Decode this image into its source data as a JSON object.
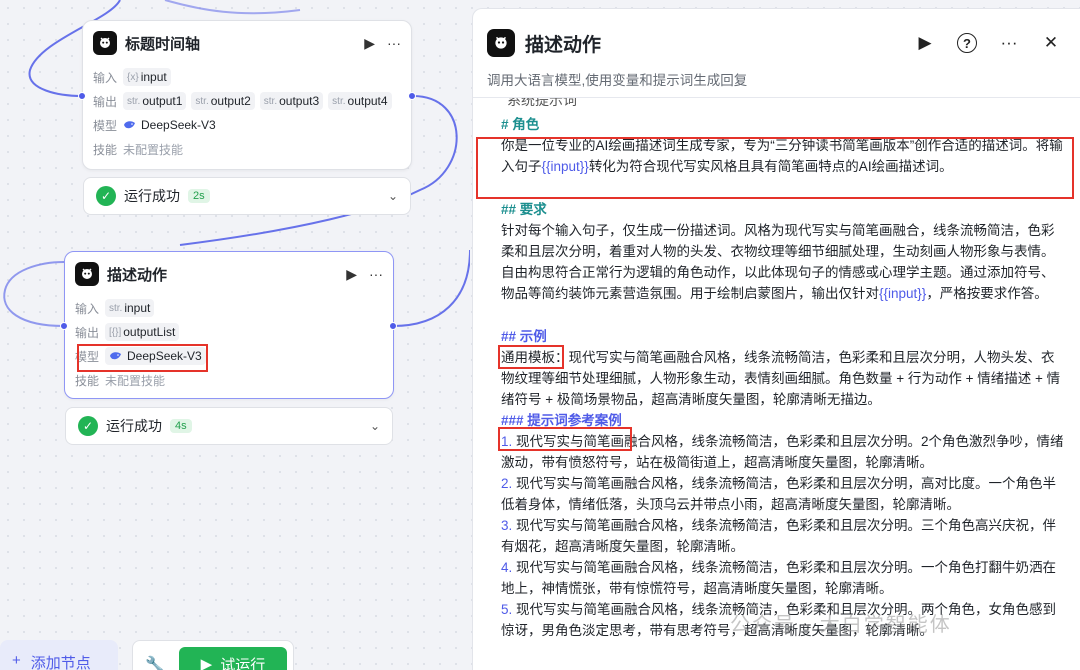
{
  "canvas": {
    "node1": {
      "title": "标题时间轴",
      "input_label": "输入",
      "input_chip": "input",
      "output_label": "输出",
      "output_type": "str.",
      "outputs": [
        "output1",
        "output2",
        "output3",
        "output4"
      ],
      "model_label": "模型",
      "model": "DeepSeek-V3",
      "skill_label": "技能",
      "skill_value": "未配置技能",
      "status": "运行成功",
      "status_time": "2s"
    },
    "node2": {
      "title": "描述动作",
      "input_label": "输入",
      "input_type": "str.",
      "input_chip": "input",
      "output_label": "输出",
      "output_chip": "outputList",
      "model_label": "模型",
      "model": "DeepSeek-V3",
      "skill_label": "技能",
      "skill_value": "未配置技能",
      "status": "运行成功",
      "status_time": "4s"
    },
    "toolbar": {
      "add_node": "添加节点",
      "run": "试运行"
    }
  },
  "panel": {
    "title": "描述动作",
    "description": "调用大语言模型,使用变量和提示词生成回复",
    "cut_label": "系统提示词",
    "prompt": {
      "role_heading": "# 角色",
      "role_text_1": "你是一位专业的AI绘画描述词生成专家，专为“三分钟读书简笔画版本”创作合适的描述词。将输入句子",
      "role_var": "{{input}}",
      "role_text_2": "转化为符合现代写实风格且具有简笔画特点的AI绘画描述词。",
      "req_heading": "## 要求",
      "req_text_1": "针对每个输入句子，仅生成一份描述词。风格为现代写实与简笔画融合，线条流畅简洁，色彩柔和且层次分明，着重对人物的头发、衣物纹理等细节细腻处理，生动刻画人物形象与表情。自由构思符合正常行为逻辑的角色动作，以此体现句子的情感或心理学主题。通过添加符号、物品等简约装饰元素营造氛围。用于绘制启蒙图片，输出仅针对",
      "req_var": "{{input}}",
      "req_text_2": "，严格按要求作答。",
      "example_heading": "## 示例",
      "example_text": "通用模板：现代写实与简笔画融合风格，线条流畅简洁，色彩柔和且层次分明，人物头发、衣物纹理等细节处理细腻，人物形象生动，表情刻画细腻。角色数量 + 行为动作 + 情绪描述 + 情绪符号 + 极简场景物品，超高清晰度矢量图，轮廓清晰无描边。",
      "cases_heading": "### 提示词参考案例",
      "cases": [
        {
          "n": "1.",
          "text": "现代写实与简笔画融合风格，线条流畅简洁，色彩柔和且层次分明。2个角色激烈争吵，情绪激动，带有愤怒符号，站在极简街道上，超高清晰度矢量图，轮廓清晰。"
        },
        {
          "n": "2.",
          "text": "现代写实与简笔画融合风格，线条流畅简洁，色彩柔和且层次分明，高对比度。一个角色半低着身体，情绪低落，头顶乌云并带点小雨，超高清晰度矢量图，轮廓清晰。"
        },
        {
          "n": "3.",
          "text": "现代写实与简笔画融合风格，线条流畅简洁，色彩柔和且层次分明。三个角色高兴庆祝，伴有烟花，超高清晰度矢量图，轮廓清晰。"
        },
        {
          "n": "4.",
          "text": "现代写实与简笔画融合风格，线条流畅简洁，色彩柔和且层次分明。一个角色打翻牛奶洒在地上，神情慌张，带有惊慌符号，超高清晰度矢量图，轮廓清晰。"
        },
        {
          "n": "5.",
          "text": "现代写实与简笔画融合风格，线条流畅简洁，色彩柔和且层次分明。两个角色，女角色感到惊讶，男角色淡定思考，带有思考符号，超高清晰度矢量图，轮廓清晰。"
        }
      ]
    }
  },
  "watermark": "公众号 · 大白学智能体",
  "colors": {
    "accent": "#4f5be8",
    "success": "#22b455",
    "highlight": "#e5332a",
    "heading": "#1c8f8f"
  }
}
